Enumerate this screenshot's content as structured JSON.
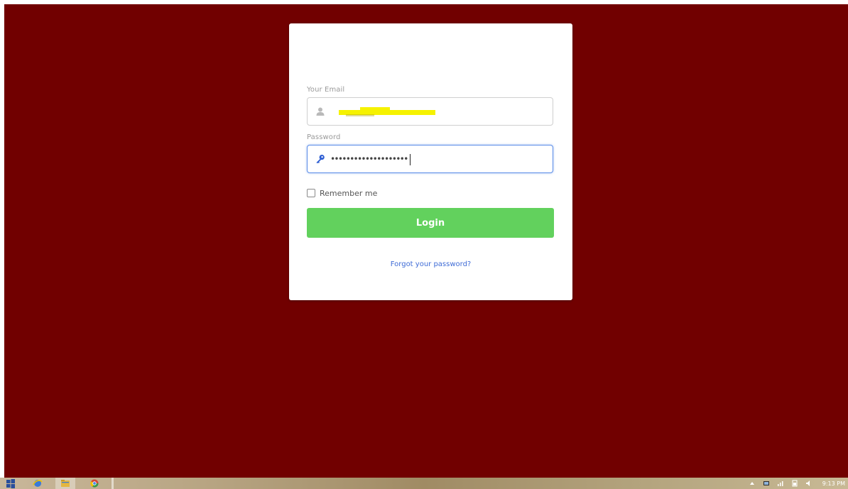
{
  "login": {
    "email_label": "Your Email",
    "email_value": "████████████",
    "password_label": "Password",
    "password_value": "••••••••••••••••••••",
    "remember_label": "Remember me",
    "remember_checked": false,
    "login_button": "Login",
    "forgot_link": "Forgot your password?"
  },
  "icons": {
    "email": "user-icon",
    "password": "key-icon"
  },
  "colors": {
    "background": "#710000",
    "card": "#ffffff",
    "login_button": "#62d15d",
    "link": "#3e6bd6",
    "focus_border": "#5b8de8",
    "redaction": "#f6f200"
  },
  "taskbar": {
    "apps": [
      "start-icon",
      "internet-explorer-icon",
      "file-explorer-icon",
      "chrome-icon"
    ],
    "clock": "9:13 PM"
  }
}
